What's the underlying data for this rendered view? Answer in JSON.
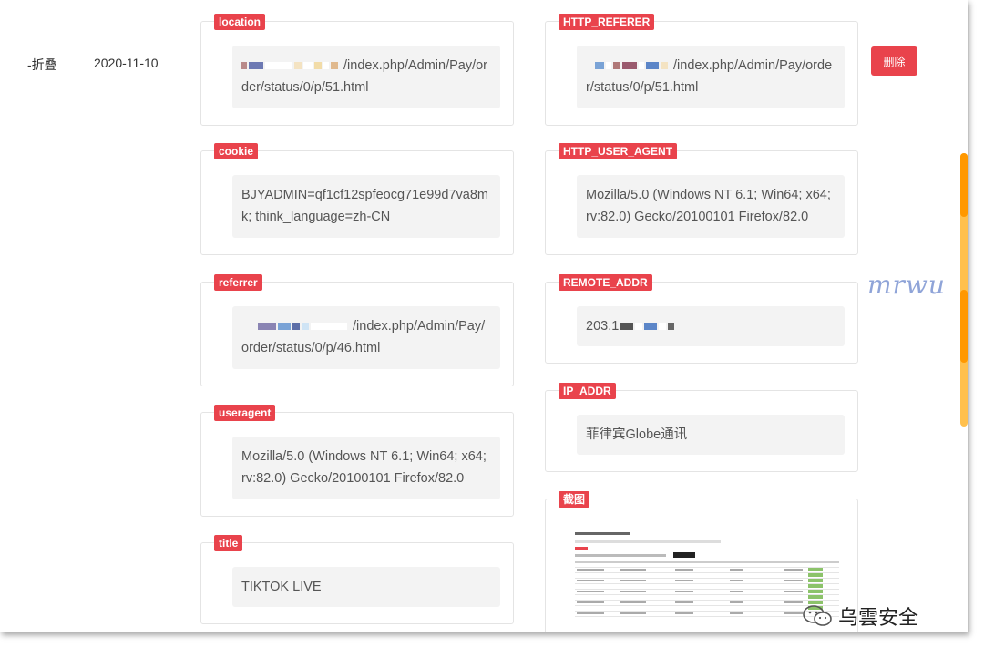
{
  "row": {
    "label": "-折叠",
    "date": "2020-11-10"
  },
  "fields": {
    "location": {
      "tag": "location",
      "value": "/index.php/Admin/Pay/order/status/0/p/51.html"
    },
    "cookie": {
      "tag": "cookie",
      "value": "BJYADMIN=qf1cf12spfeocg71e99d7va8mk; think_language=zh-CN"
    },
    "referrer": {
      "tag": "referrer",
      "value": "/index.php/Admin/Pay/order/status/0/p/46.html"
    },
    "useragent": {
      "tag": "useragent",
      "value": "Mozilla/5.0 (Windows NT 6.1; Win64; x64; rv:82.0) Gecko/20100101 Firefox/82.0"
    },
    "title": {
      "tag": "title",
      "value": "TIKTOK LIVE"
    },
    "http_referer": {
      "tag": "HTTP_REFERER",
      "value": "/index.php/Admin/Pay/order/status/0/p/51.html"
    },
    "http_user_agent": {
      "tag": "HTTP_USER_AGENT",
      "value": "Mozilla/5.0 (Windows NT 6.1; Win64; x64; rv:82.0) Gecko/20100101 Firefox/82.0"
    },
    "remote_addr": {
      "tag": "REMOTE_ADDR",
      "value": "203.1"
    },
    "ip_addr": {
      "tag": "IP_ADDR",
      "value": "菲律宾Globe通讯"
    },
    "screenshot": {
      "tag": "截图"
    }
  },
  "actions": {
    "delete_label": "删除"
  },
  "overlay": {
    "signature": "mrwu",
    "watermark": "乌雲安全"
  },
  "colors": {
    "accent": "#e9434c",
    "scroll": "#ff9800"
  }
}
